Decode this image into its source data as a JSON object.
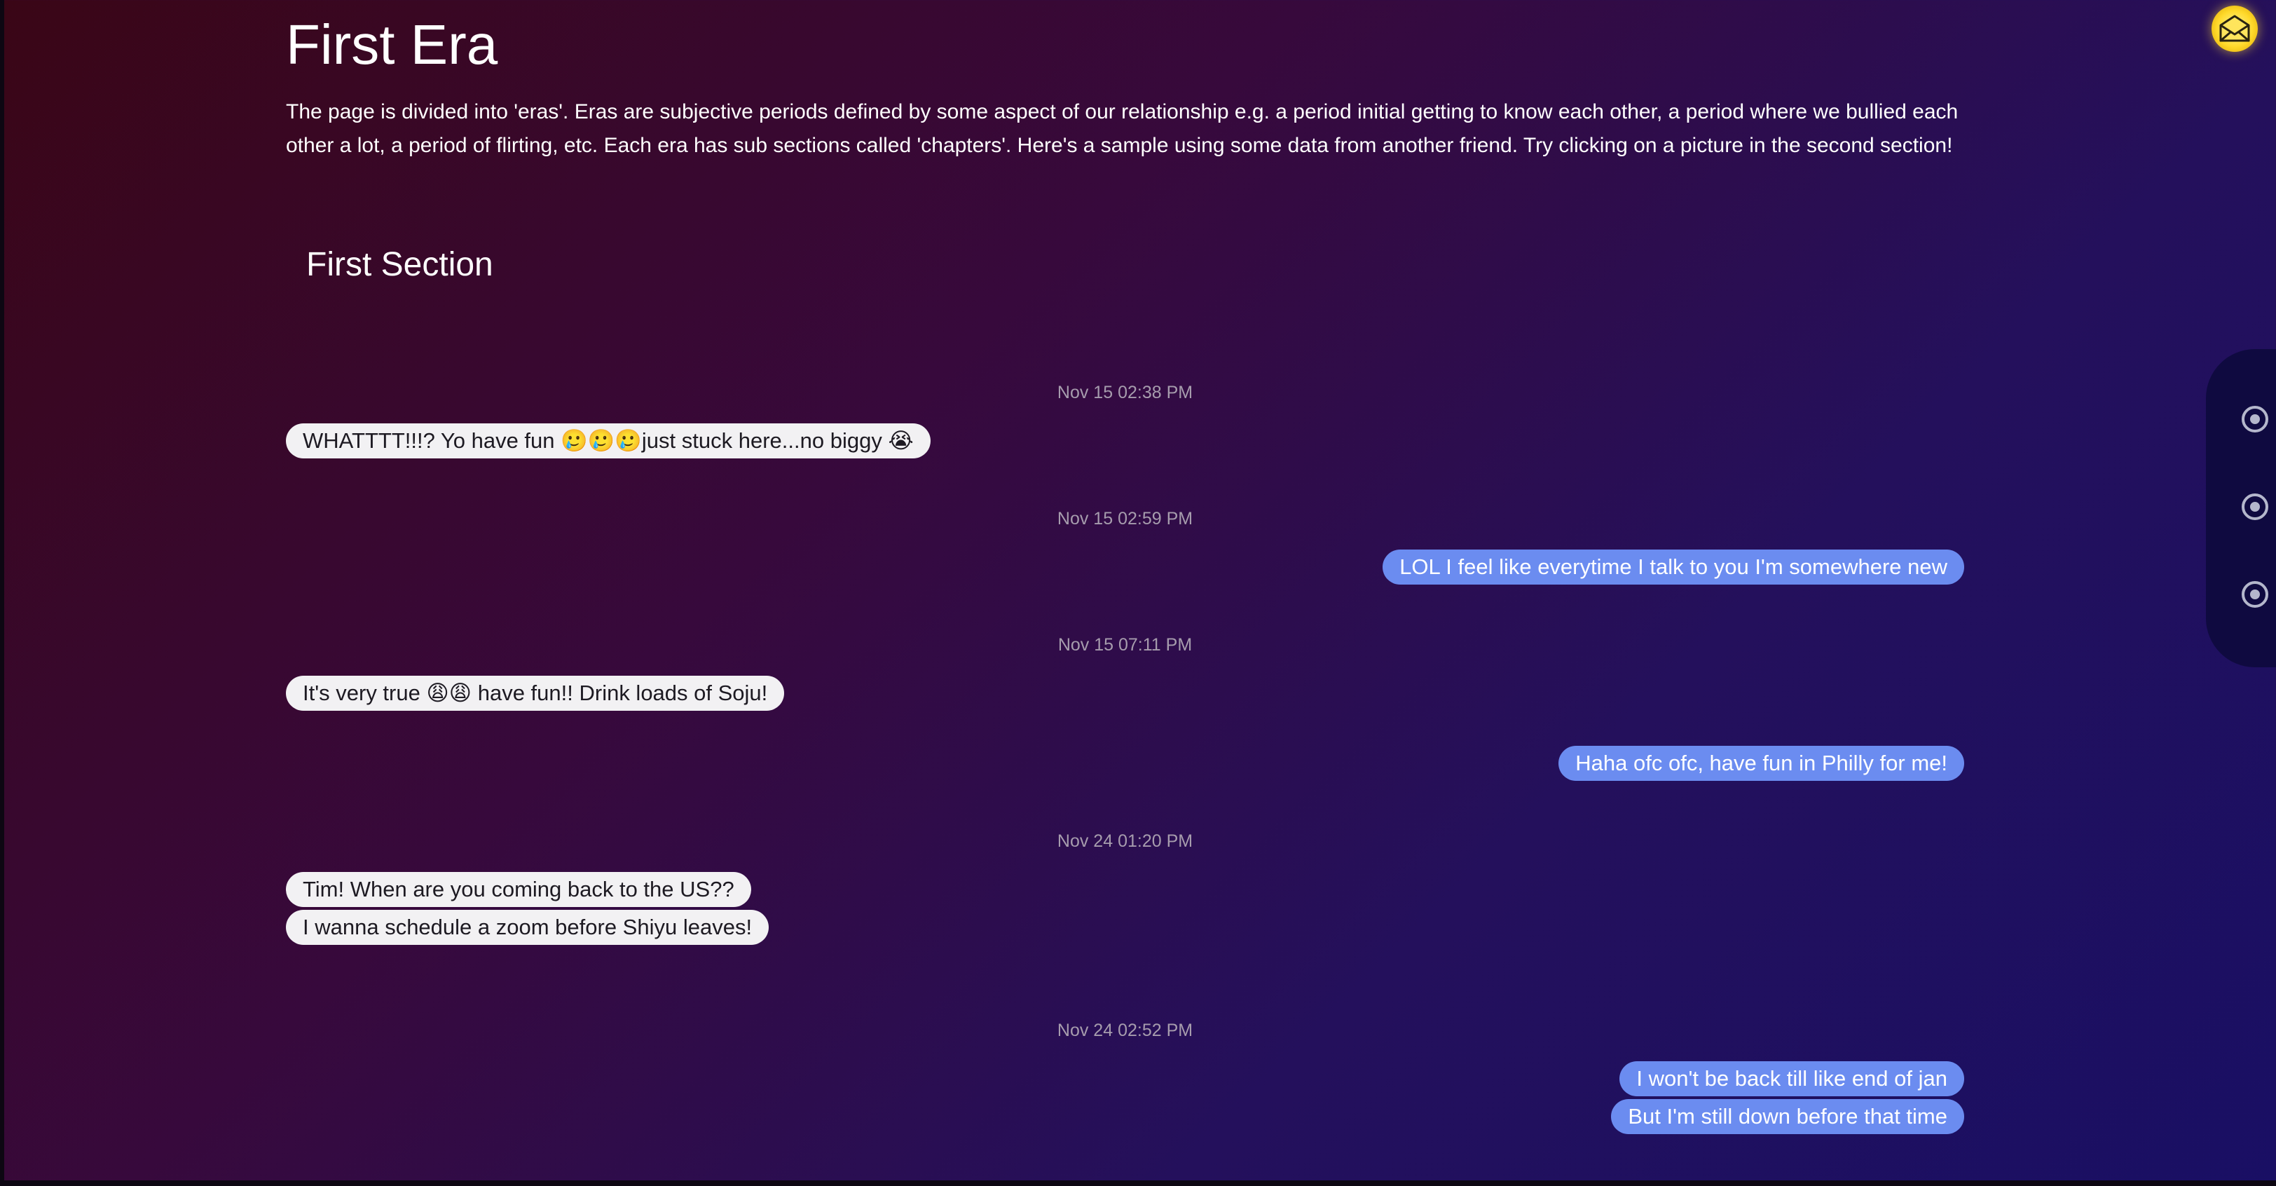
{
  "era": {
    "title": "First Era",
    "description": "The page is divided into 'eras'. Eras are subjective periods defined by some aspect of our relationship e.g. a period initial getting to know each other, a period where we bullied each other a lot, a period of flirting, etc. Each era has sub sections called 'chapters'. Here's a sample using some data from another friend. Try clicking on a picture in the second section!"
  },
  "section": {
    "title": "First Section"
  },
  "conversation": {
    "timestamps": [
      "Nov 15 02:38 PM",
      "Nov 15 02:59 PM",
      "Nov 15 07:11 PM",
      "Nov 24 01:20 PM",
      "Nov 24 02:52 PM"
    ],
    "messages": [
      {
        "direction": "received",
        "text": "WHATTTT!!!? Yo have fun 🥲🥲🥲just stuck here...no biggy 😭"
      },
      {
        "direction": "sent",
        "text": "LOL I feel like everytime I talk to you I'm somewhere new"
      },
      {
        "direction": "received",
        "text": "It's very true 😩😩 have fun!! Drink loads of Soju!"
      },
      {
        "direction": "sent",
        "text": "Haha ofc ofc, have fun in Philly for me!"
      },
      {
        "direction": "received",
        "text": "Tim! When are you coming back to the US??"
      },
      {
        "direction": "received",
        "text": "I wanna schedule a zoom before Shiyu leaves!"
      },
      {
        "direction": "sent",
        "text": "I won't be back till like end of jan"
      },
      {
        "direction": "sent",
        "text": "But I'm still down before that time"
      }
    ]
  },
  "colors": {
    "received_bubble": "#f2f1f3",
    "sent_bubble": "#6b8cf0",
    "timestamp": "#a69cad",
    "avatar": "#ffd92a"
  },
  "icons": {
    "avatar": "envelope-avatar-icon",
    "navigation": "radio-dot-icon"
  }
}
